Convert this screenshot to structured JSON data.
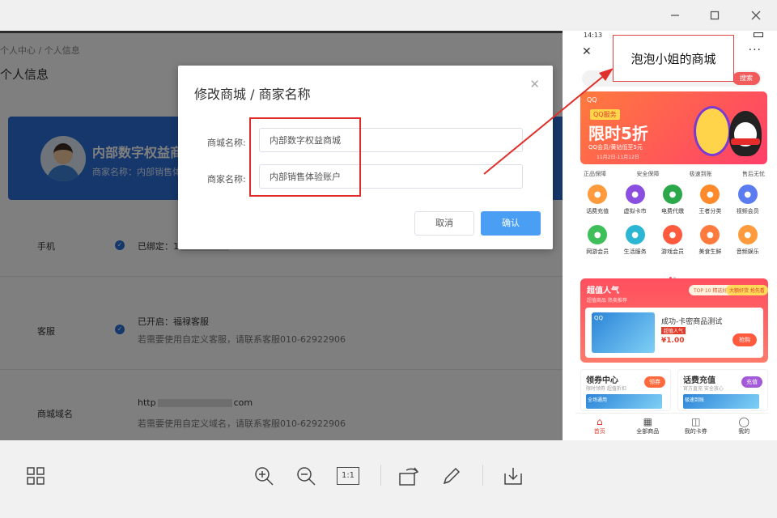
{
  "window": {
    "minimize_icon": "minimize-icon",
    "maximize_icon": "maximize-icon",
    "close_icon": "close-icon"
  },
  "admin": {
    "breadcrumb": "个人中心 / 个人信息",
    "title": "个人信息",
    "card": {
      "name": "内部数字权益商",
      "merchant": "商家名称：内部销售体"
    },
    "rows": [
      {
        "label": "手机",
        "text": "已绑定：1",
        "hint": ""
      },
      {
        "label": "客服",
        "text": "已开启：福禄客服",
        "hint": "若需要使用自定义客服，请联系客服010-62922906"
      },
      {
        "label": "商城域名",
        "text_prefix": "http",
        "text_suffix": "com",
        "hint": "若需要使用自定义域名，请联系客服010-62922906"
      }
    ]
  },
  "dialog": {
    "title": "修改商城 / 商家名称",
    "mall_label": "商城名称:",
    "mall_value": "内部数字权益商城",
    "merchant_label": "商家名称:",
    "merchant_value": "内部销售体验账户",
    "cancel": "取消",
    "confirm": "确认"
  },
  "callout": {
    "text": "泡泡小姐的商城"
  },
  "phone": {
    "time": "14:13",
    "search_button": "搜索",
    "banner": {
      "brand": "QQ",
      "tag": "QQ服务",
      "headline": "限时5折",
      "sub": "QQ会员/黄钻低至5元",
      "dates": "11月2日-11月12日"
    },
    "guarantees": [
      "正品保障",
      "安全保障",
      "极速到账",
      "售后无忧"
    ],
    "grid": [
      {
        "label": "话费充值",
        "color": "#ff9b3d",
        "icon": "phone-icon"
      },
      {
        "label": "虚拟卡市",
        "color": "#8a4fe0",
        "icon": "card-icon"
      },
      {
        "label": "电费代缴",
        "color": "#2ba84a",
        "icon": "bolt-icon"
      },
      {
        "label": "王者分类",
        "color": "#ff8a2b",
        "icon": "game-icon"
      },
      {
        "label": "视频会员",
        "color": "#5a7cf0",
        "icon": "tv-icon"
      },
      {
        "label": "网游会员",
        "color": "#3fbf5a",
        "icon": "gamepad-icon"
      },
      {
        "label": "生活服务",
        "color": "#2bb6d4",
        "icon": "home-icon"
      },
      {
        "label": "游戏会员",
        "color": "#ff5a3d",
        "icon": "star-icon"
      },
      {
        "label": "美食生鲜",
        "color": "#ff7a3d",
        "icon": "food-icon"
      },
      {
        "label": "音频娱乐",
        "color": "#ff9b3d",
        "icon": "music-icon"
      }
    ],
    "hot": {
      "title": "超值人气",
      "sub": "超值商品 热卖推荐",
      "top": "TOP 10 精选好货",
      "badge": "大额好货 抢先看",
      "item_name": "成功-卡密商品测试",
      "item_tag": "超值人气",
      "price": "¥1.00",
      "buy": "抢购"
    },
    "coupon": {
      "title": "领券中心",
      "sub": "限时领券 超值折扣",
      "button": "领券",
      "img": "全场通用"
    },
    "recharge": {
      "title": "话费充值",
      "sub": "官方直充 安全放心",
      "button": "充值",
      "img": "极速到账"
    },
    "tabs": [
      "首页",
      "全部商品",
      "我的卡券",
      "我的"
    ]
  },
  "toolbar": {
    "items": [
      "grid-view-icon",
      "zoom-in-icon",
      "zoom-out-icon",
      "actual-size-icon",
      "rotate-icon",
      "edit-icon",
      "download-icon"
    ],
    "actual_size_label": "1:1"
  }
}
